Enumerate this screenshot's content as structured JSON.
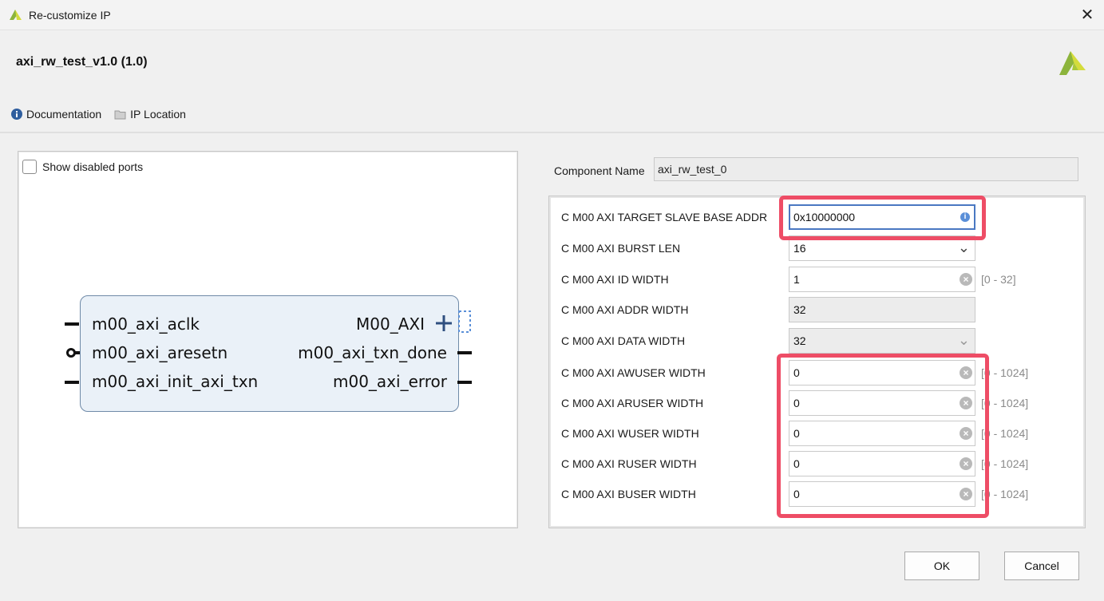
{
  "window": {
    "title": "Re-customize IP",
    "close_glyph": "✕"
  },
  "header": {
    "title": "axi_rw_test_v1.0 (1.0)"
  },
  "links": [
    {
      "label": "Documentation",
      "icon": "info-icon"
    },
    {
      "label": "IP Location",
      "icon": "folder-icon"
    }
  ],
  "left_panel": {
    "show_disabled_label": "Show disabled ports",
    "block": {
      "left_ports": [
        "m00_axi_aclk",
        "m00_axi_aresetn",
        "m00_axi_init_axi_txn"
      ],
      "right_ports": [
        "M00_AXI",
        "m00_axi_txn_done",
        "m00_axi_error"
      ]
    }
  },
  "component": {
    "label": "Component Name",
    "value": "axi_rw_test_0"
  },
  "params": [
    {
      "label": "C M00 AXI TARGET SLAVE BASE ADDR",
      "value": "0x10000000",
      "range": ""
    },
    {
      "label": "C M00 AXI BURST LEN",
      "value": "16",
      "range": ""
    },
    {
      "label": "C M00 AXI ID WIDTH",
      "value": "1",
      "range": "[0 - 32]"
    },
    {
      "label": "C M00 AXI ADDR WIDTH",
      "value": "32",
      "range": ""
    },
    {
      "label": "C M00 AXI DATA WIDTH",
      "value": "32",
      "range": ""
    },
    {
      "label": "C M00 AXI AWUSER WIDTH",
      "value": "0",
      "range": "[0 - 1024]"
    },
    {
      "label": "C M00 AXI ARUSER WIDTH",
      "value": "0",
      "range": "[0 - 1024]"
    },
    {
      "label": "C M00 AXI WUSER WIDTH",
      "value": "0",
      "range": "[0 - 1024]"
    },
    {
      "label": "C M00 AXI RUSER WIDTH",
      "value": "0",
      "range": "[0 - 1024]"
    },
    {
      "label": "C M00 AXI BUSER WIDTH",
      "value": "0",
      "range": "[0 - 1024]"
    }
  ],
  "buttons": {
    "ok": "OK",
    "cancel": "Cancel"
  },
  "colors": {
    "highlight": "#ee4d66",
    "focus": "#4a78c2",
    "logo_green": "#8cb43c",
    "logo_yellow": "#d4dc3c"
  }
}
